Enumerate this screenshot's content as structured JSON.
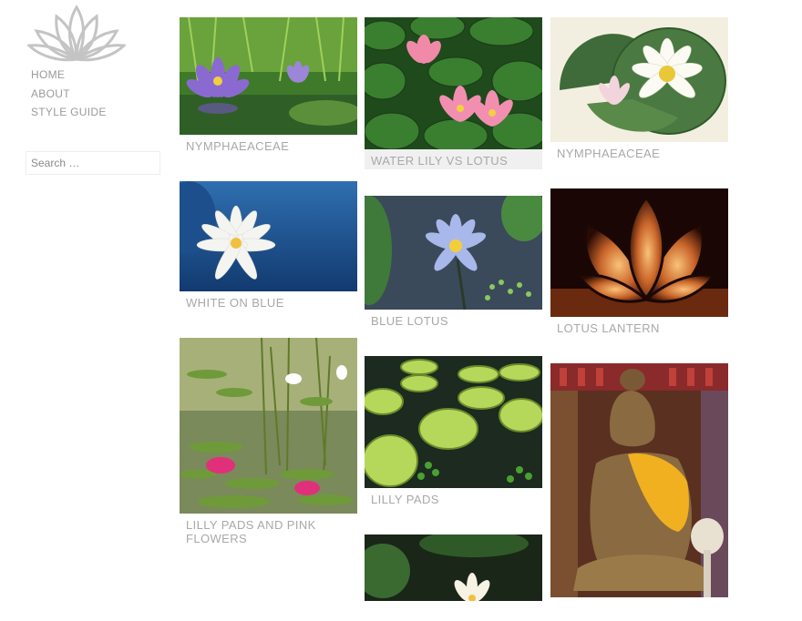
{
  "site": {
    "logo_icon": "lotus-logo-icon"
  },
  "nav": {
    "items": [
      {
        "label": "HOME"
      },
      {
        "label": "ABOUT"
      },
      {
        "label": "STYLE GUIDE"
      }
    ]
  },
  "search": {
    "placeholder": "Search …"
  },
  "posts": [
    {
      "caption": "NYMPHAEACEAE"
    },
    {
      "caption": "WATER LILY VS LOTUS"
    },
    {
      "caption": "NYMPHAEACEAE"
    },
    {
      "caption": "WHITE ON BLUE"
    },
    {
      "caption": "BLUE LOTUS"
    },
    {
      "caption": "LOTUS LANTERN"
    },
    {
      "caption": "LILLY PADS AND PINK FLOWERS"
    },
    {
      "caption": "LILLY PADS"
    },
    {
      "caption": ""
    },
    {
      "caption": ""
    }
  ]
}
